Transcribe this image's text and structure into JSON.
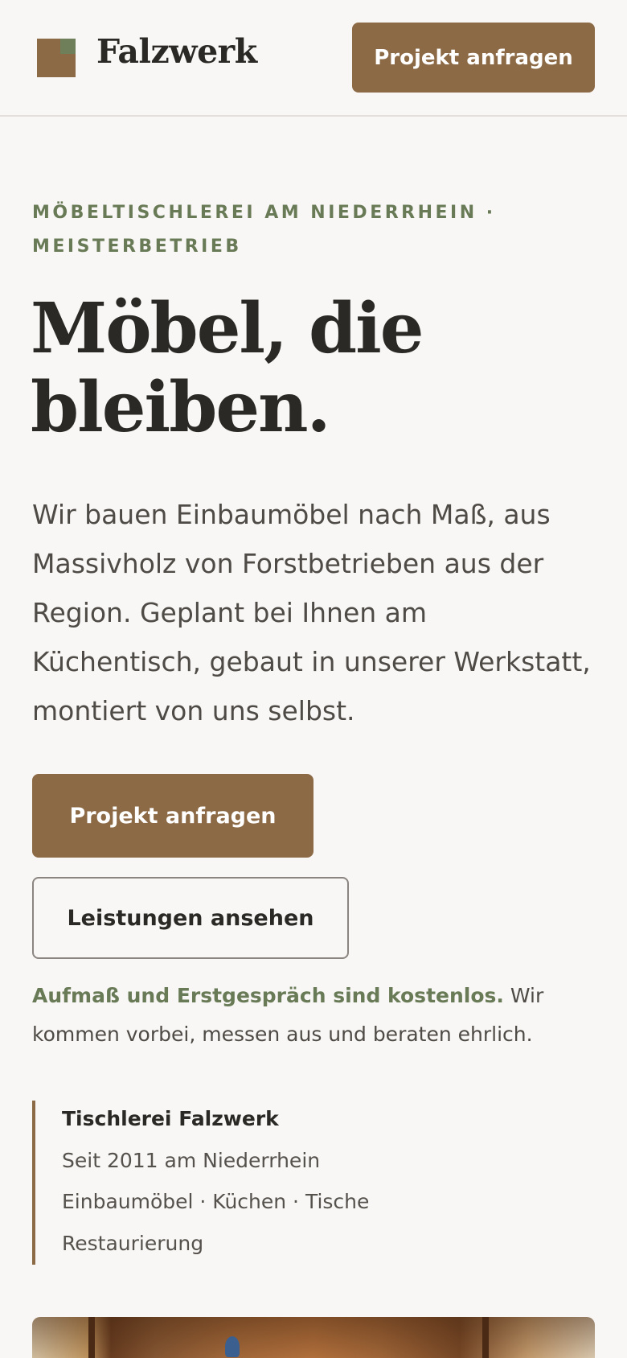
{
  "header": {
    "brand": "Falzwerk",
    "cta_label": "Projekt anfragen",
    "logo_icon": "square-logo-icon"
  },
  "hero": {
    "eyebrow": "Möbeltischlerei am Niederrhein · Meisterbetrieb",
    "headline": "Möbel, die bleiben.",
    "lede": "Wir bauen Einbaumöbel nach Maß, aus Massivholz von Forstbetrieben aus der Region. Geplant bei Ihnen am Küchentisch, gebaut in unserer Werkstatt, montiert von uns selbst.",
    "primary_button": "Projekt anfragen",
    "secondary_button": "Leistungen ansehen",
    "note_strong": "Aufmaß und Erstgespräch sind kostenlos.",
    "note_rest": " Wir kommen vorbei, messen aus und beraten ehrlich."
  },
  "info_card": {
    "title": "Tischlerei Falzwerk",
    "lines": [
      "Seit 2011 am Niederrhein",
      "Einbaumöbel · Küchen · Tische",
      "Restaurierung"
    ]
  },
  "colors": {
    "accent": "#8d6a46",
    "accent_green": "#687a56",
    "background": "#f9f7f5",
    "text": "#2b2925"
  }
}
